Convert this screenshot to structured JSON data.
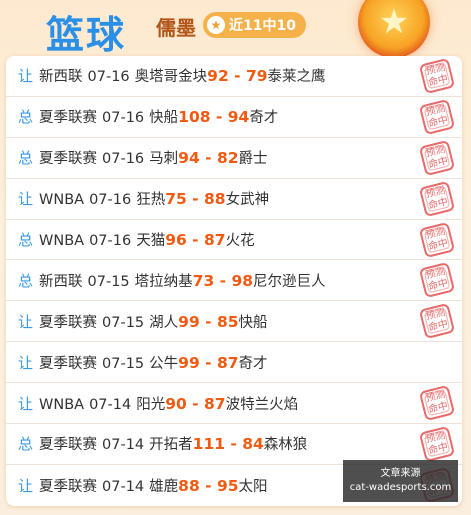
{
  "header": {
    "title": "篮球",
    "author": "儒墨",
    "badge": "近11中10",
    "badge_icon": "star-icon"
  },
  "stamp_text": {
    "line1": "预测",
    "line2": "命中"
  },
  "rows": [
    {
      "tag": "让",
      "league": "新西联",
      "date": "07-16",
      "home": "奥塔哥金块",
      "score": "92 - 79",
      "away": "泰莱之鹰",
      "hit": true
    },
    {
      "tag": "总",
      "league": "夏季联赛",
      "date": "07-16",
      "home": "快船",
      "score": "108 - 94",
      "away": "奇才",
      "hit": true
    },
    {
      "tag": "总",
      "league": "夏季联赛",
      "date": "07-16",
      "home": "马刺",
      "score": "94 - 82",
      "away": "爵士",
      "hit": true
    },
    {
      "tag": "让",
      "league": "WNBA",
      "date": "07-16",
      "home": "狂热",
      "score": "75 - 88",
      "away": "女武神",
      "hit": true
    },
    {
      "tag": "总",
      "league": "WNBA",
      "date": "07-16",
      "home": "天猫",
      "score": "96 - 87",
      "away": "火花",
      "hit": true
    },
    {
      "tag": "总",
      "league": "新西联",
      "date": "07-15",
      "home": "塔拉纳基",
      "score": "73 - 98",
      "away": "尼尔逊巨人",
      "hit": true
    },
    {
      "tag": "让",
      "league": "夏季联赛",
      "date": "07-15",
      "home": "湖人",
      "score": "99 - 85",
      "away": "快船",
      "hit": true
    },
    {
      "tag": "让",
      "league": "夏季联赛",
      "date": "07-15",
      "home": "公牛",
      "score": "99 - 87",
      "away": "奇才",
      "hit": false
    },
    {
      "tag": "让",
      "league": "WNBA",
      "date": "07-14",
      "home": "阳光",
      "score": "90 - 87",
      "away": "波特兰火焰",
      "hit": true
    },
    {
      "tag": "总",
      "league": "夏季联赛",
      "date": "07-14",
      "home": "开拓者",
      "score": "111 - 84",
      "away": "森林狼",
      "hit": true
    },
    {
      "tag": "让",
      "league": "夏季联赛",
      "date": "07-14",
      "home": "雄鹿",
      "score": "88 - 95",
      "away": "太阳",
      "hit": true
    }
  ],
  "watermark": {
    "line1": "文章来源",
    "line2": "cat-wadesports.com"
  },
  "colors": {
    "title": "#2a8fe6",
    "score": "#f25a12",
    "tag": "#3a9ae8",
    "stamp": "#e65a5a"
  }
}
